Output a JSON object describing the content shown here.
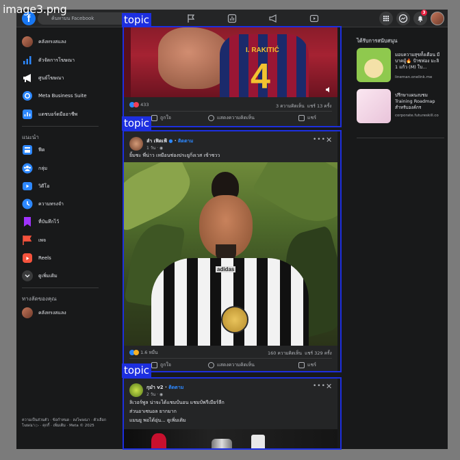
{
  "watermark": "image3.png",
  "topic_label": "topic",
  "topbar": {
    "search_placeholder": "ค้นหาบน Facebook",
    "notification_count": "3"
  },
  "sidebar": {
    "items": [
      {
        "label": "คลังทรงสแลง",
        "icon": "profile-avatar",
        "color": "#a0522d"
      },
      {
        "label": "ตัวจัดการโฆษณา",
        "icon": "bar-chart-icon",
        "color": "#2d88ff"
      },
      {
        "label": "ศูนย์โฆษณา",
        "icon": "megaphone-icon",
        "color": "#ffffff"
      },
      {
        "label": "Meta Business Suite",
        "icon": "business-suite-icon",
        "color": "#2d88ff"
      },
      {
        "label": "แดชบอร์ดมืออาชีพ",
        "icon": "dashboard-icon",
        "color": "#2d88ff"
      }
    ],
    "section_title": "แนะนำ",
    "shortcuts": [
      {
        "label": "ฟีด",
        "icon": "feed-icon",
        "color": "#2d88ff"
      },
      {
        "label": "กลุ่ม",
        "icon": "groups-icon",
        "color": "#2d88ff"
      },
      {
        "label": "วิดีโอ",
        "icon": "video-icon",
        "color": "#2d88ff"
      },
      {
        "label": "ความทรงจำ",
        "icon": "memories-icon",
        "color": "#2d88ff"
      },
      {
        "label": "ที่บันทึกไว้",
        "icon": "saved-icon",
        "color": "#a033ff"
      },
      {
        "label": "เพจ",
        "icon": "pages-icon",
        "color": "#f5533d"
      },
      {
        "label": "Reels",
        "icon": "reels-icon",
        "color": "#f5533d"
      },
      {
        "label": "ดูเพิ่มเติม",
        "icon": "chevron-down-icon",
        "color": "#3a3b3c"
      }
    ],
    "shortcuts_title": "ทางลัดของคุณ",
    "your_shortcuts": [
      {
        "label": "คลังทรงสแลง",
        "icon": "profile-avatar",
        "color": "#a0522d"
      }
    ],
    "footer": "ความเป็นส่วนตัว · ข้อกำหนด · ลงโฆษณา · ตัวเลือกโฆษณา ▷ · คุกกี้ · เพิ่มเติม · Meta © 2025"
  },
  "posts": [
    {
      "reactions_count": "433",
      "comments": "3 ความคิดเห็น",
      "shares": "แชร์ 13 ครั้ง",
      "jersey_name": "I. RAKITIĆ",
      "jersey_number": "4",
      "actions": [
        "ถูกใจ",
        "แสดงความคิดเห็น",
        "แชร์"
      ]
    },
    {
      "author": "ลำ เฟิดเฟ้",
      "follow": "ติดตาม",
      "time": "1 วัน · ",
      "caption": "ยิ้มซะ พี่น่าว เหมือนช่องประยูกิ่งเวส เข้าซวว",
      "reactions_count": "1.6 หมื่น",
      "comments": "160 ความคิดเห็น",
      "shares": "แชร์ 329 ครั้ง",
      "shirt_brand": "adidas",
      "actions": [
        "ถูกใจ",
        "แสดงความคิดเห็น",
        "แชร์"
      ]
    },
    {
      "author": "กุมำ v2",
      "follow": "ติดตาม",
      "time": "2 วัน · ",
      "lines": [
        "ลิเวอร์พูล น่าจะได้แชมป์นอน แชมป์พรีเมียร์ลีก",
        "ส่วนอาเซนอล     ยากมาก",
        "แมนยู      พอได้อุ่น... ดูเพิ่มเติม"
      ]
    }
  ],
  "right": {
    "title": "ได้รับการสนับสนุน",
    "ads": [
      {
        "text": "มอบความสุขทั้งเดือน มีบาคมู้🔥 ป้าซฟอง มะลิ 1 แก้ว (M) ใบ...",
        "url": "lineman.onelink.me",
        "color": "#9bd25a"
      },
      {
        "text": "ปรึกษาแผนงบชม Training Roadmap สำหรับองค์กร",
        "url": "corporate.futureskill.co",
        "color": "#f4dbe8"
      }
    ]
  }
}
